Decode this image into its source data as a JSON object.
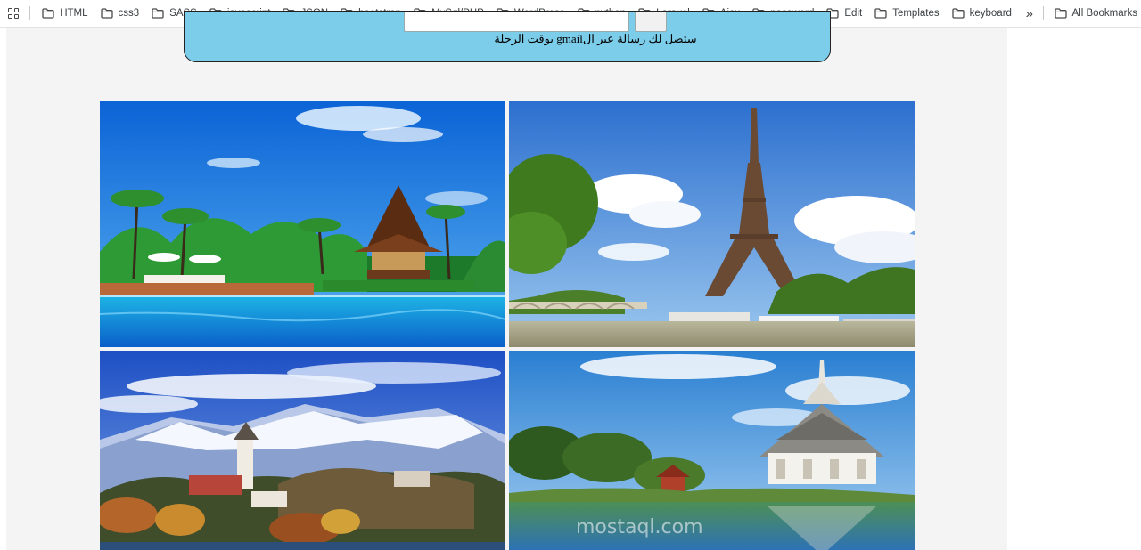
{
  "bookmarks_bar": {
    "items": [
      {
        "label": "HTML"
      },
      {
        "label": "css3"
      },
      {
        "label": "SASS"
      },
      {
        "label": "javascript"
      },
      {
        "label": "JSON"
      },
      {
        "label": "bootstrap"
      },
      {
        "label": "MySql/PHP"
      },
      {
        "label": "WordPress"
      },
      {
        "label": "python"
      },
      {
        "label": "Laravel"
      },
      {
        "label": "Ajax"
      },
      {
        "label": "password"
      },
      {
        "label": "Edit"
      },
      {
        "label": "Templates"
      },
      {
        "label": "keyboard"
      }
    ],
    "more_icon": "double-chevron-right-icon",
    "all_bookmarks_label": "All Bookmarks",
    "apps_icon": "apps-grid-icon",
    "folder_icon": "folder-icon"
  },
  "booking_panel": {
    "notice_text": "ستصل لك رسالة عبر الgmail بوقت الرحلة",
    "color": "#7ccdea"
  },
  "gallery": {
    "images": [
      {
        "name": "tropical-resort-pool-image"
      },
      {
        "name": "eiffel-tower-paris-image"
      },
      {
        "name": "lake-bled-castle-image"
      },
      {
        "name": "thai-temple-lake-image"
      }
    ],
    "watermark_text": "mostaql.com"
  }
}
